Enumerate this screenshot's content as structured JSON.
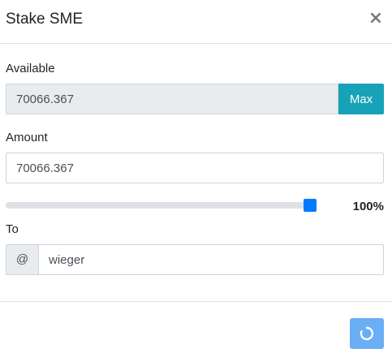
{
  "modal": {
    "title": "Stake SME",
    "close_label": "×"
  },
  "available": {
    "label": "Available",
    "value": "70066.367",
    "max_label": "Max"
  },
  "amount": {
    "label": "Amount",
    "value": "70066.367"
  },
  "slider": {
    "value_percent": 100,
    "display": "100%"
  },
  "to": {
    "label": "To",
    "prefix": "@",
    "value": "wieger"
  },
  "footer": {
    "submit_state": "loading"
  },
  "colors": {
    "accent_info": "#17a2b8",
    "slider_thumb": "#007bff",
    "submit_button": "#6aaef5"
  },
  "icons": {
    "close": "close-icon",
    "spinner": "spinner-icon"
  }
}
